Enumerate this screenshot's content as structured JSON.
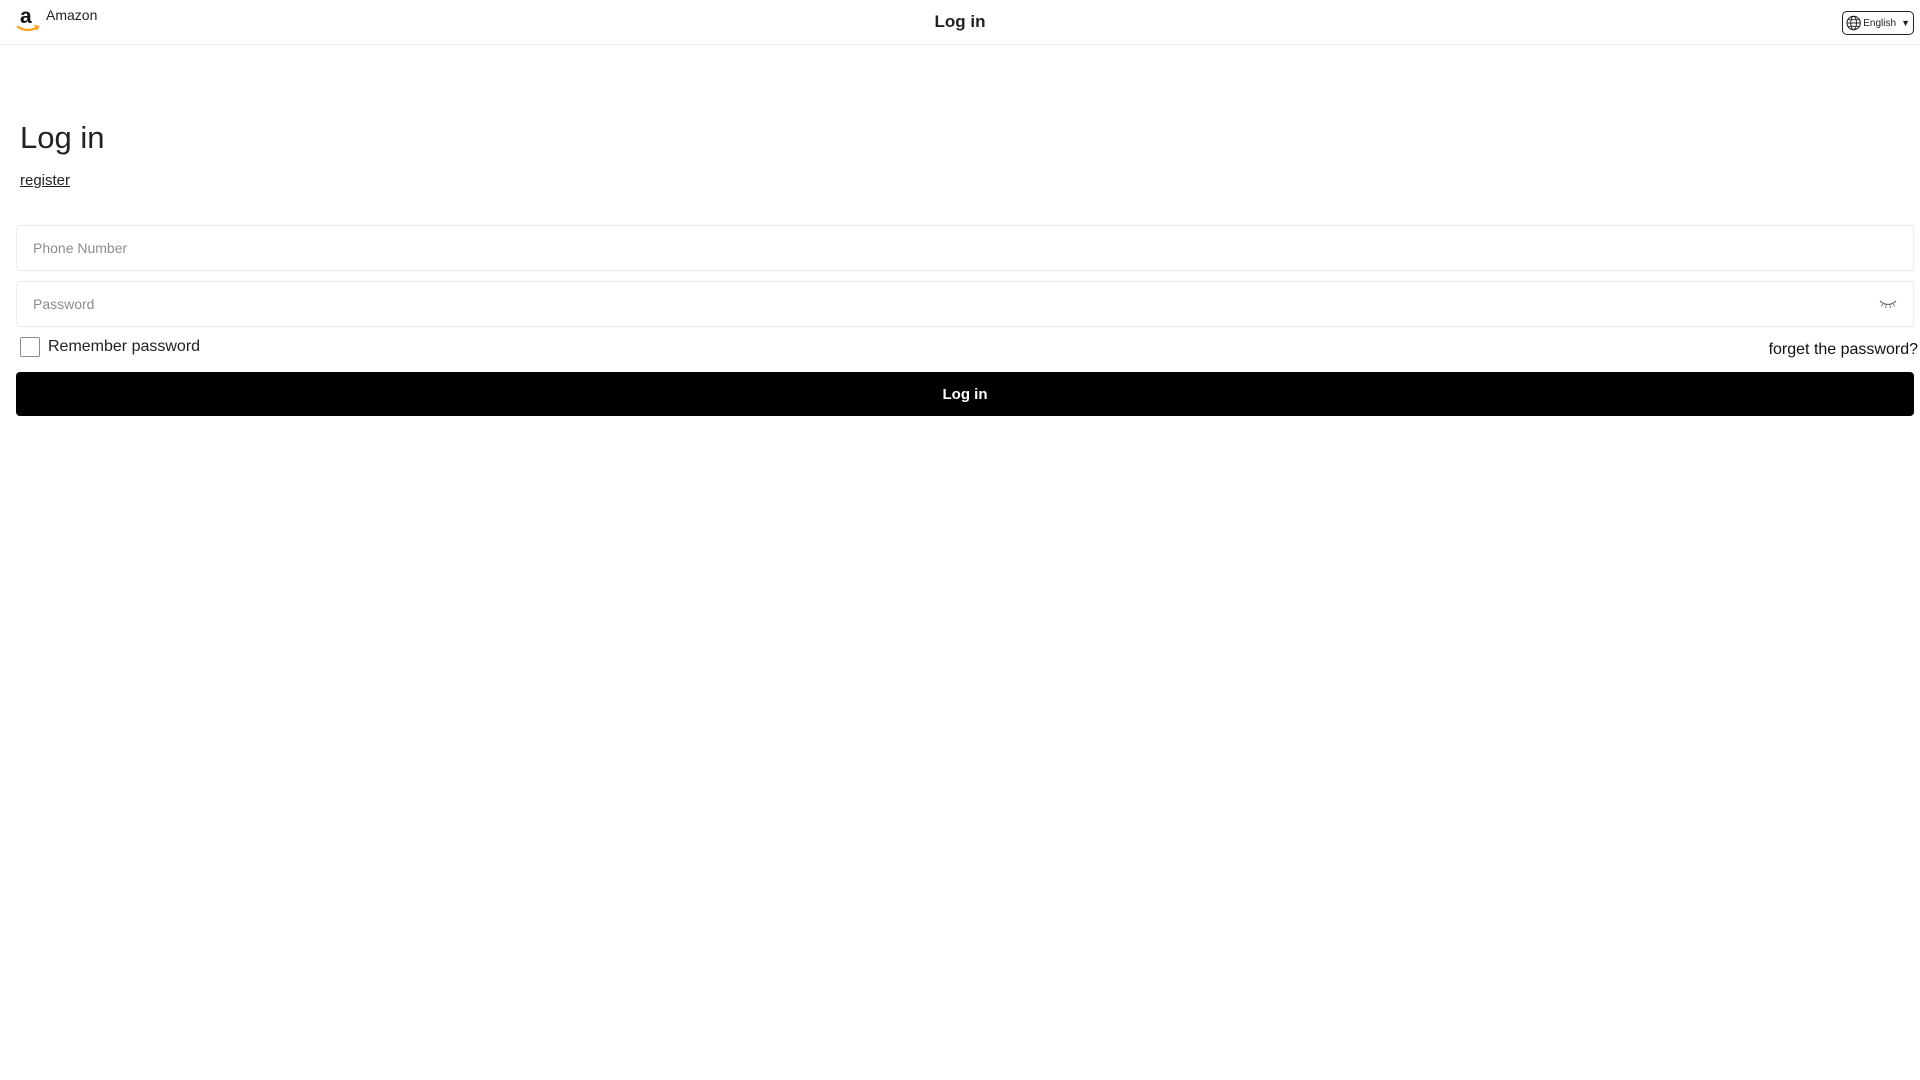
{
  "header": {
    "brand_name": "Amazon",
    "title": "Log in",
    "language": {
      "selected": "English",
      "icon": "globe-icon"
    }
  },
  "main": {
    "heading": "Log in",
    "register_link": "register",
    "phone_field": {
      "value": "",
      "placeholder": "Phone Number"
    },
    "password_field": {
      "value": "",
      "placeholder": "Password",
      "toggle_icon": "eye-closed-icon"
    },
    "remember_password": {
      "label": "Remember password",
      "checked": false
    },
    "forgot_password_link": "forget the password?",
    "login_button": "Log in"
  },
  "colors": {
    "button_background": "#000000",
    "button_text": "#ffffff",
    "logo_smile": "#f5a623"
  }
}
